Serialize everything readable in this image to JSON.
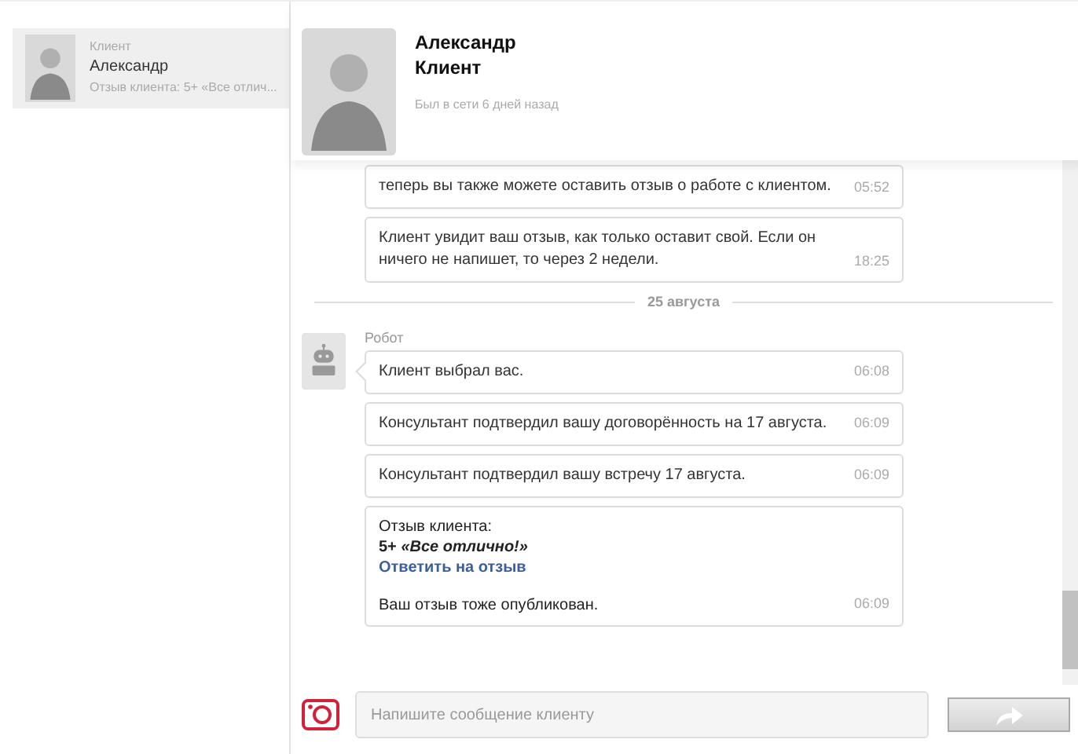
{
  "sidebar": {
    "items": [
      {
        "role": "Клиент",
        "name": "Александр",
        "preview": "Отзыв клиента: 5+ «Все отлич...",
        "selected": true
      }
    ]
  },
  "header": {
    "first_name": "Александр",
    "last_name": "Клиент",
    "status": "Был в сети 6 дней назад"
  },
  "messages": [
    {
      "kind": "text",
      "text": "теперь вы также можете оставить отзыв о работе с клиентом.",
      "time": "05:52"
    },
    {
      "kind": "text",
      "text": "Клиент увидит ваш отзыв, как только оставит свой. Если он ничего не напишет, то через 2 недели.",
      "time": "18:25"
    },
    {
      "kind": "date",
      "text": "25 августа"
    },
    {
      "kind": "sender",
      "text": "Робот"
    },
    {
      "kind": "text",
      "text": "Клиент выбрал вас.",
      "time": "06:08",
      "first": true
    },
    {
      "kind": "text",
      "text": "Консультант подтвердил вашу договорённость на 17 августа.",
      "time": "06:09"
    },
    {
      "kind": "text",
      "text": "Консультант подтвердил вашу встречу 17 августа.",
      "time": "06:09"
    },
    {
      "kind": "review",
      "label": "Отзыв клиента:",
      "rating": "5+ *«Все отлично!»*",
      "link": "Ответить на отзыв",
      "text": "Ваш отзыв тоже опубликован.",
      "time": "06:09"
    }
  ],
  "composer": {
    "placeholder": "Напишите сообщение клиенту"
  }
}
